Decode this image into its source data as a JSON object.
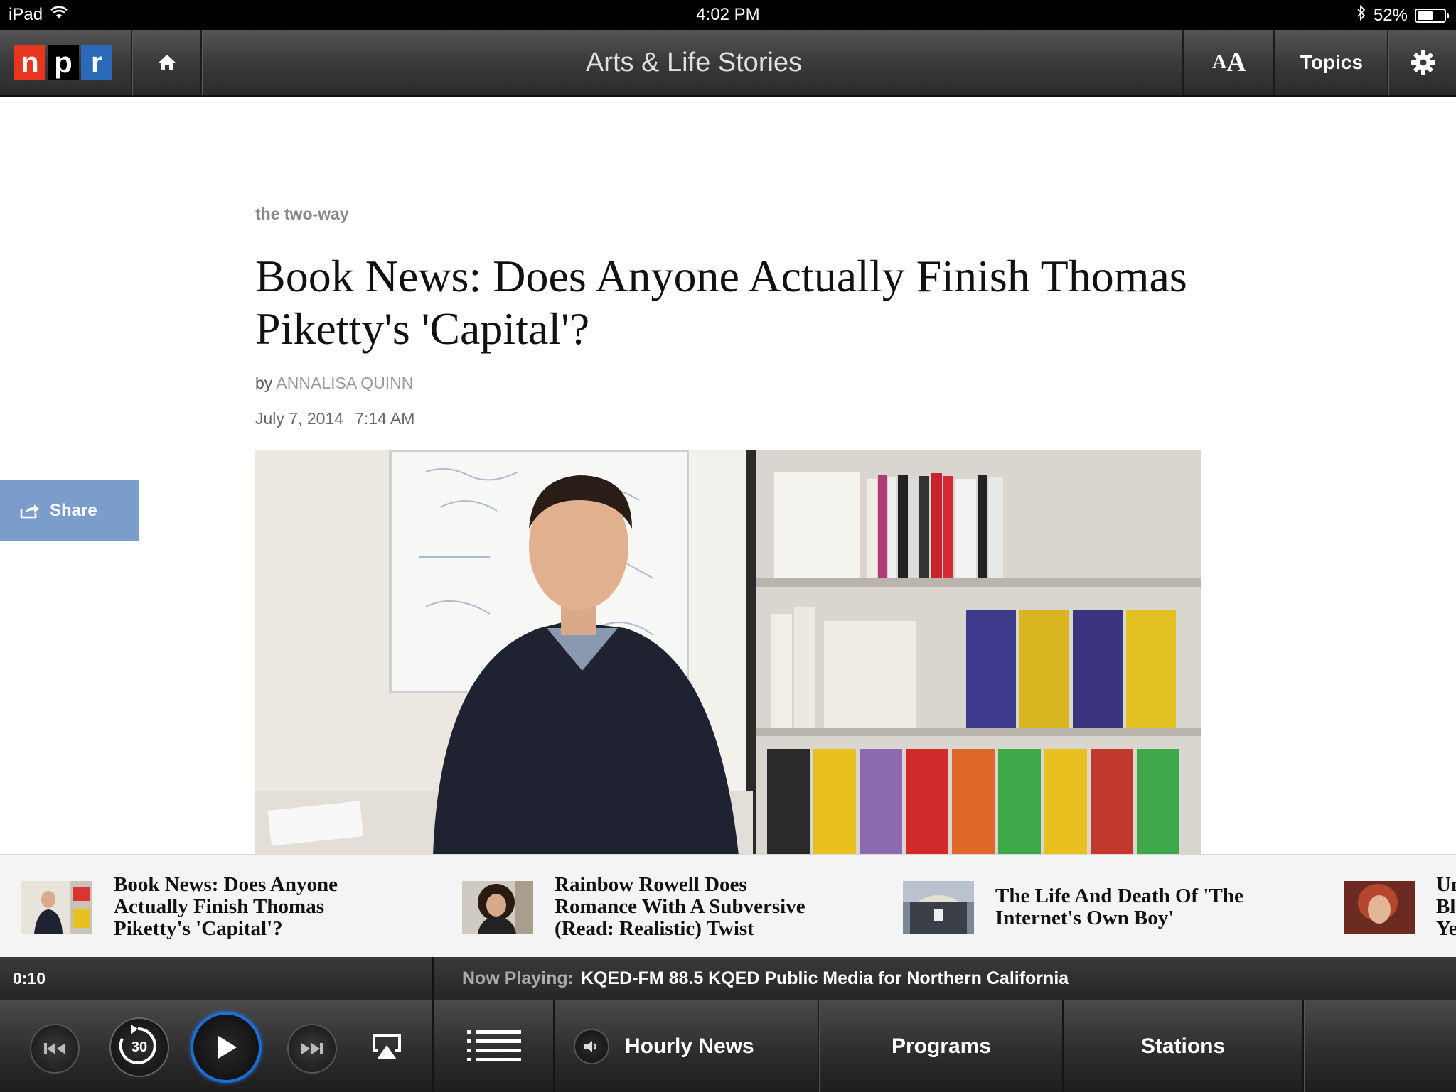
{
  "status_bar": {
    "device": "iPad",
    "time": "4:02 PM",
    "battery": "52%"
  },
  "nav": {
    "logo_letters": [
      "n",
      "p",
      "r"
    ],
    "title": "Arts & Life Stories",
    "font_small": "A",
    "font_large": "A",
    "topics_label": "Topics"
  },
  "article": {
    "section": "the two-way",
    "headline": "Book News: Does Anyone Actually Finish Thomas Piketty's 'Capital'?",
    "byline_prefix": "by",
    "author": "ANNALISA QUINN",
    "date": "July 7, 2014",
    "time": "7:14 AM"
  },
  "share": {
    "label": "Share"
  },
  "related": [
    {
      "title": "Book News: Does Anyone Actually Finish Thomas Piketty's 'Capital'?"
    },
    {
      "title": "Rainbow Rowell Does Romance With A Subversive (Read: Realistic) Twist"
    },
    {
      "title": "The Life And Death Of 'The Internet's Own Boy'"
    },
    {
      "title": "Un Bl Ye"
    }
  ],
  "player": {
    "elapsed": "0:10",
    "now_playing_label": "Now Playing:",
    "now_playing_value": "KQED-FM 88.5 KQED Public Media for Northern California",
    "skip_back_seconds": "30"
  },
  "toolbar": {
    "hourly_news": "Hourly News",
    "programs": "Programs",
    "stations": "Stations"
  },
  "colors": {
    "npr_red": "#e8361e",
    "npr_blue": "#2a6ab8",
    "share_blue": "#7a9dcc",
    "play_ring": "#1d6fd6"
  }
}
